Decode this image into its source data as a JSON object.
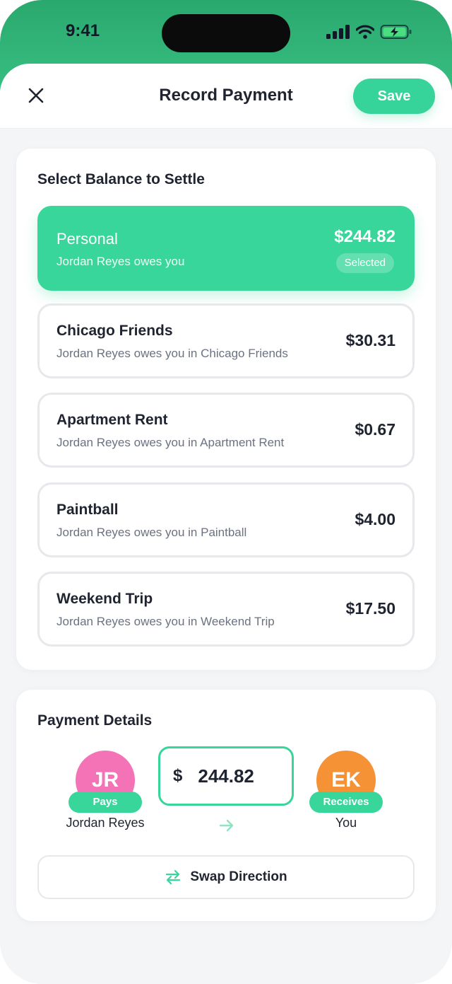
{
  "status": {
    "time": "9:41"
  },
  "header": {
    "title": "Record Payment",
    "save_label": "Save"
  },
  "balances": {
    "heading": "Select Balance to Settle",
    "items": [
      {
        "name": "Personal",
        "subtitle": "Jordan Reyes owes you",
        "amount": "$244.82",
        "badge": "Selected"
      },
      {
        "name": "Chicago Friends",
        "subtitle": "Jordan Reyes owes you in Chicago Friends",
        "amount": "$30.31"
      },
      {
        "name": "Apartment Rent",
        "subtitle": "Jordan Reyes owes you in Apartment Rent",
        "amount": "$0.67"
      },
      {
        "name": "Paintball",
        "subtitle": "Jordan Reyes owes you in Paintball",
        "amount": "$4.00"
      },
      {
        "name": "Weekend Trip",
        "subtitle": "Jordan Reyes owes you in Weekend Trip",
        "amount": "$17.50"
      }
    ]
  },
  "payment": {
    "heading": "Payment Details",
    "payer": {
      "initials": "JR",
      "role": "Pays",
      "name": "Jordan Reyes",
      "color": "#f472b6"
    },
    "receiver": {
      "initials": "EK",
      "role": "Receives",
      "name": "You",
      "color": "#f59236"
    },
    "currency": "$",
    "amount": "244.82",
    "swap_label": "Swap Direction"
  },
  "colors": {
    "accent": "#38d69b",
    "text": "#1f2430",
    "muted": "#6b7280"
  }
}
